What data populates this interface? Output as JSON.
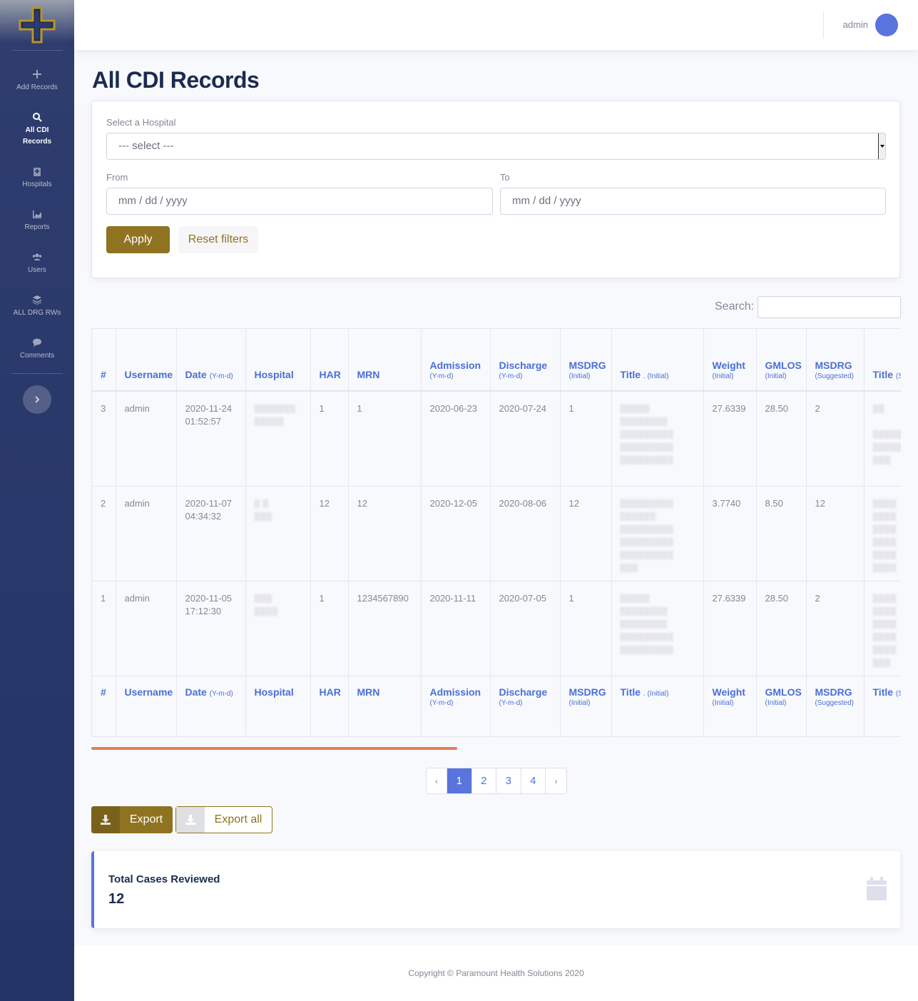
{
  "sidebar": {
    "items": [
      {
        "label": "Add Records",
        "icon": "plus-icon"
      },
      {
        "label": "All CDI Records",
        "icon": "search-icon",
        "active": true
      },
      {
        "label": "Hospitals",
        "icon": "hospital-icon"
      },
      {
        "label": "Reports",
        "icon": "area-chart-icon"
      },
      {
        "label": "Users",
        "icon": "users-icon"
      },
      {
        "label": "ALL DRG RWs",
        "icon": "layers-icon"
      },
      {
        "label": "Comments",
        "icon": "comment-icon"
      }
    ],
    "toggle_icon": "chevron-right-icon"
  },
  "topbar": {
    "username": "admin"
  },
  "page": {
    "title": "All CDI Records"
  },
  "filters": {
    "hospital_label": "Select a Hospital",
    "hospital_value": "--- select ---",
    "from_label": "From",
    "from_placeholder": "mm / dd / yyyy",
    "to_label": "To",
    "to_placeholder": "mm / dd / yyyy",
    "apply_label": "Apply",
    "reset_label": "Reset filters"
  },
  "search": {
    "label": "Search:"
  },
  "table": {
    "columns": [
      {
        "label": "#",
        "sub": ""
      },
      {
        "label": "Username",
        "sub": ""
      },
      {
        "label": "Date",
        "sub": "(Y-m-d)"
      },
      {
        "label": "Hospital",
        "sub": ""
      },
      {
        "label": "HAR",
        "sub": ""
      },
      {
        "label": "MRN",
        "sub": ""
      },
      {
        "label": "Admission",
        "sub": "(Y-m-d)"
      },
      {
        "label": "Discharge",
        "sub": "(Y-m-d)"
      },
      {
        "label": "MSDRG",
        "sub": "(Initial)"
      },
      {
        "label": "Title",
        "sub": ". (Initial)"
      },
      {
        "label": "Weight",
        "sub": "(Initial)"
      },
      {
        "label": "GMLOS",
        "sub": "(Initial)"
      },
      {
        "label": "MSDRG",
        "sub": "(Suggested)"
      },
      {
        "label": "Title",
        "sub": "(S"
      }
    ],
    "rows": [
      {
        "id": "3",
        "username": "admin",
        "date": "2020-11-24",
        "time": "01:52:57",
        "har": "1",
        "mrn": "1",
        "admission": "2020-06-23",
        "discharge": "2020-07-24",
        "msdrg_initial": "1",
        "weight": "27.6339",
        "gmlos": "28.50",
        "msdrg_suggested": "2"
      },
      {
        "id": "2",
        "username": "admin",
        "date": "2020-11-07",
        "time": "04:34:32",
        "har": "12",
        "mrn": "12",
        "admission": "2020-12-05",
        "discharge": "2020-08-06",
        "msdrg_initial": "12",
        "weight": "3.7740",
        "gmlos": "8.50",
        "msdrg_suggested": "12"
      },
      {
        "id": "1",
        "username": "admin",
        "date": "2020-11-05",
        "time": "17:12:30",
        "har": "1",
        "mrn": "1234567890",
        "admission": "2020-11-11",
        "discharge": "2020-07-05",
        "msdrg_initial": "1",
        "weight": "27.6339",
        "gmlos": "28.50",
        "msdrg_suggested": "2"
      }
    ]
  },
  "pagination": {
    "prev": "‹",
    "pages": [
      "1",
      "2",
      "3",
      "4"
    ],
    "next": "›",
    "active": "1"
  },
  "export": {
    "export_label": "Export",
    "export_all_label": "Export all"
  },
  "summary": {
    "label": "Total Cases Reviewed",
    "value": "12",
    "icon": "calendar-icon"
  },
  "footer": {
    "text": "Copyright © Paramount Health Solutions 2020"
  },
  "colors": {
    "sidebar": "#243466",
    "accent_gold": "#8f7320",
    "primary": "#5a74dd",
    "scroll_bar": "#e07f5b",
    "heading": "#1c2b50"
  }
}
